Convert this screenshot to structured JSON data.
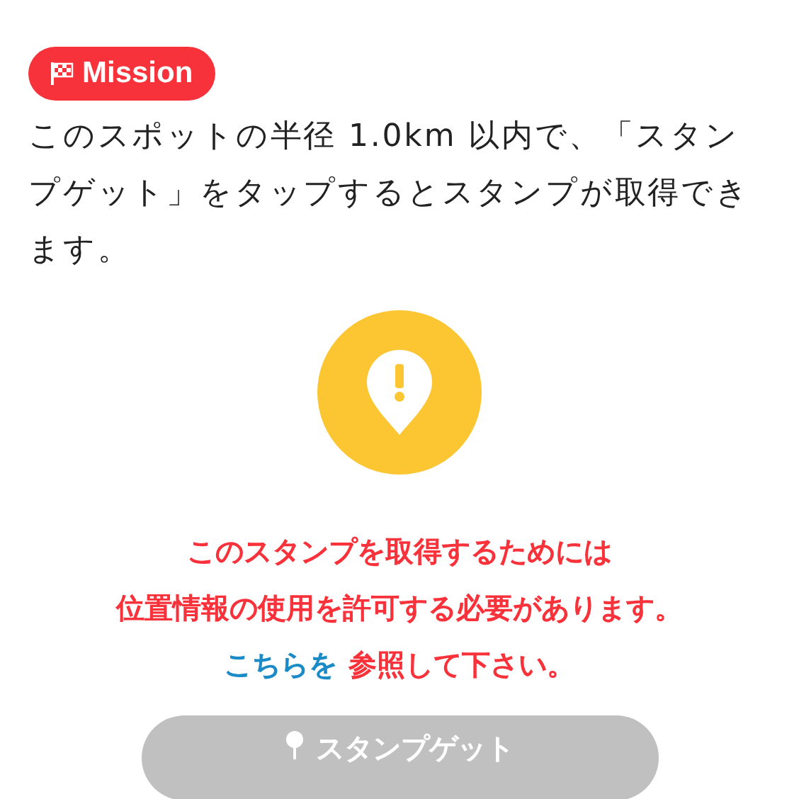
{
  "mission": {
    "badge": "Mission",
    "description": "このスポットの半径 1.0km 以内で、「スタンプゲット」をタップするとスタンプが取得できます。"
  },
  "notice": {
    "lines": [
      "このスタンプを取得するためには",
      "位置情報の使用を許可する必要があります。"
    ],
    "link": "こちらを",
    "link_suffix": "参照して下さい。"
  },
  "button": {
    "label": "スタンプゲット",
    "disabled": true
  }
}
